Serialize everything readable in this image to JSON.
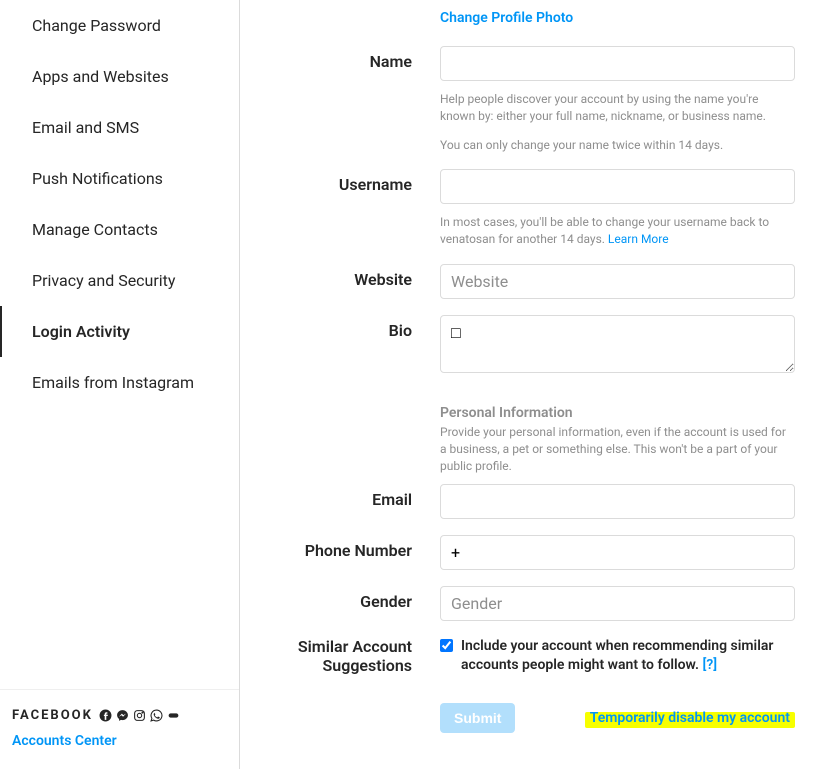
{
  "sidebar": {
    "items": [
      {
        "label": "Change Password"
      },
      {
        "label": "Apps and Websites"
      },
      {
        "label": "Email and SMS"
      },
      {
        "label": "Push Notifications"
      },
      {
        "label": "Manage Contacts"
      },
      {
        "label": "Privacy and Security"
      },
      {
        "label": "Login Activity"
      },
      {
        "label": "Emails from Instagram"
      }
    ],
    "footer": {
      "brand": "FACEBOOK",
      "accounts_center": "Accounts Center"
    }
  },
  "form": {
    "change_photo": "Change Profile Photo",
    "name": {
      "label": "Name",
      "value": "",
      "help1": "Help people discover your account by using the name you're known by: either your full name, nickname, or business name.",
      "help2": "You can only change your name twice within 14 days."
    },
    "username": {
      "label": "Username",
      "value": "",
      "help": "In most cases, you'll be able to change your username back to venatosan for another 14 days.",
      "learn_more": "Learn More"
    },
    "website": {
      "label": "Website",
      "placeholder": "Website",
      "value": ""
    },
    "bio": {
      "label": "Bio",
      "value": "□"
    },
    "personal": {
      "title": "Personal Information",
      "desc": "Provide your personal information, even if the account is used for a business, a pet or something else. This won't be a part of your public profile."
    },
    "email": {
      "label": "Email",
      "value": ""
    },
    "phone": {
      "label": "Phone Number",
      "value": "+"
    },
    "gender": {
      "label": "Gender",
      "placeholder": "Gender",
      "value": ""
    },
    "suggestions": {
      "label": "Similar Account Suggestions",
      "checkbox_label": "Include your account when recommending similar accounts people might want to follow.",
      "help_q": "[?]",
      "checked": true
    },
    "submit": "Submit",
    "disable": "Temporarily disable my account"
  }
}
